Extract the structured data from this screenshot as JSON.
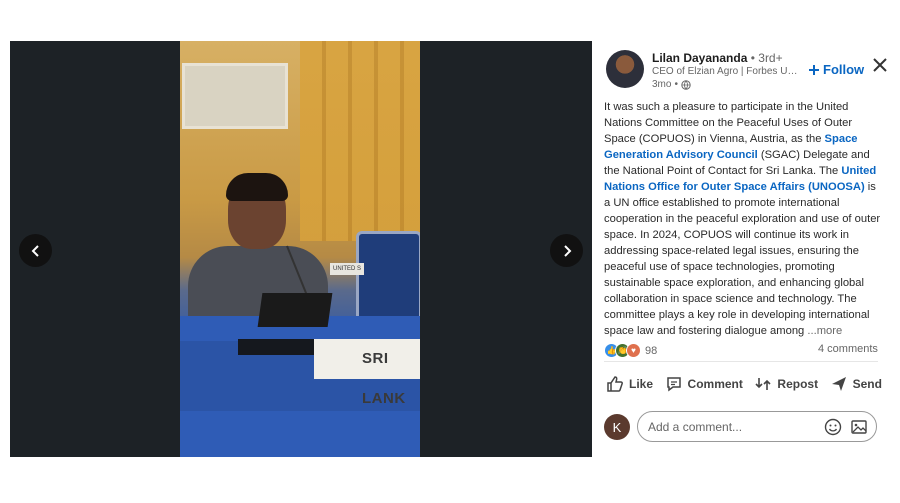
{
  "author": {
    "name": "Lilan Dayananda",
    "degree": "3rd+",
    "headline": "CEO of Elzian Agro | Forbes Under 30",
    "time": "3mo",
    "follow_label": "Follow"
  },
  "post": {
    "p1": "It was such a pleasure to participate in the United Nations Committee on the Peaceful Uses of Outer Space (COPUOS) in Vienna, Austria, as the ",
    "link1": "Space Generation Advisory Council",
    "p2": " (SGAC) Delegate and the National Point of Contact for Sri Lanka. The ",
    "link2": "United Nations Office for Outer Space Affairs (UNOOSA)",
    "p3": " is a UN office established to promote international cooperation in the peaceful exploration and use of outer space. In 2024, COPUOS will continue its work in addressing space-related legal issues, ensuring the peaceful use of space technologies, promoting sustainable space exploration, and enhancing global collaboration in space science and technology. The committee plays a key role in developing international space law and fostering dialogue among ",
    "more": "...more"
  },
  "social": {
    "reaction_count": "98",
    "comments": "4 comments"
  },
  "actions": {
    "like": "Like",
    "comment": "Comment",
    "repost": "Repost",
    "send": "Send"
  },
  "composer": {
    "avatar_letter": "K",
    "placeholder": "Add a comment..."
  },
  "photo": {
    "nameplate": "SRI LANK",
    "small_plate": "UNITED S"
  },
  "colors": {
    "link": "#0a66c2",
    "viewer_bg": "#1d2226"
  },
  "icons": [
    "chevron-left-icon",
    "chevron-right-icon",
    "close-icon",
    "globe-icon",
    "plus-icon",
    "like-icon",
    "comment-icon",
    "repost-icon",
    "send-icon",
    "emoji-icon",
    "image-icon"
  ]
}
